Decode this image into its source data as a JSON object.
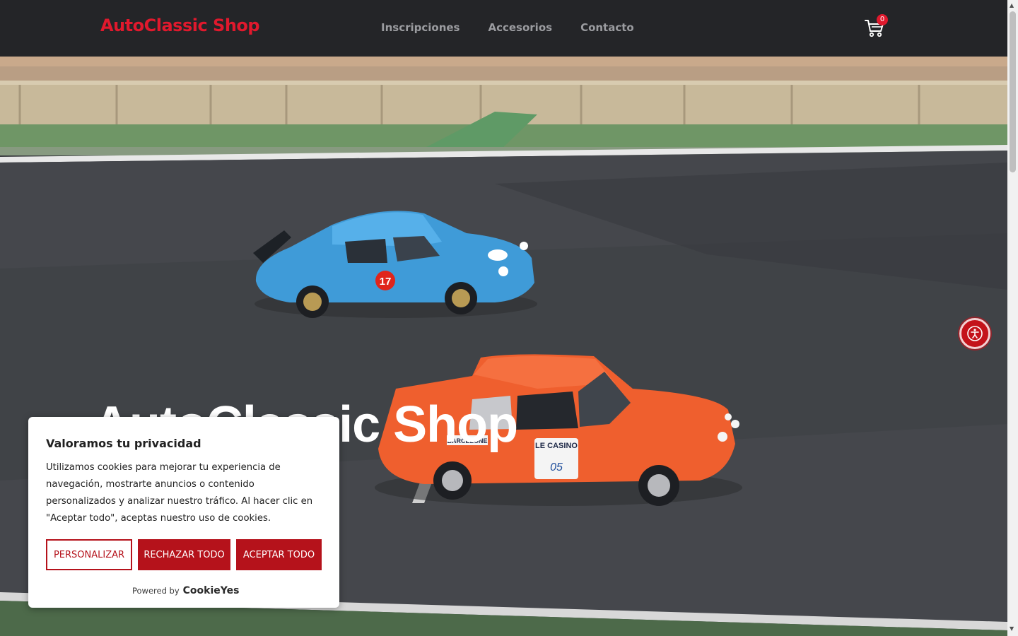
{
  "header": {
    "logo": "AutoClassic Shop",
    "nav": [
      "Inscripciones",
      "Accesorios",
      "Contacto"
    ],
    "cart_count": "0"
  },
  "hero": {
    "title": "AutoClassic Shop",
    "car1_number": "17",
    "car2_plate": "LE CASINO",
    "car2_number": "05",
    "car2_sticker": "BARCELONE"
  },
  "cookie": {
    "title": "Valoramos tu privacidad",
    "text": "Utilizamos cookies para mejorar tu experiencia de navegación, mostrarte anuncios o contenido personalizados y analizar nuestro tráfico. Al hacer clic en \"Aceptar todo\", aceptas nuestro uso de cookies.",
    "customize": "PERSONALIZAR",
    "reject": "RECHAZAR TODO",
    "accept": "ACEPTAR TODO",
    "powered_by": "Powered by",
    "brand": "CookieYes"
  },
  "colors": {
    "brand": "#e0192d",
    "header_bg": "#242528",
    "cookie_button": "#b5121b"
  },
  "icons": [
    "cart-icon",
    "accessibility-icon"
  ]
}
